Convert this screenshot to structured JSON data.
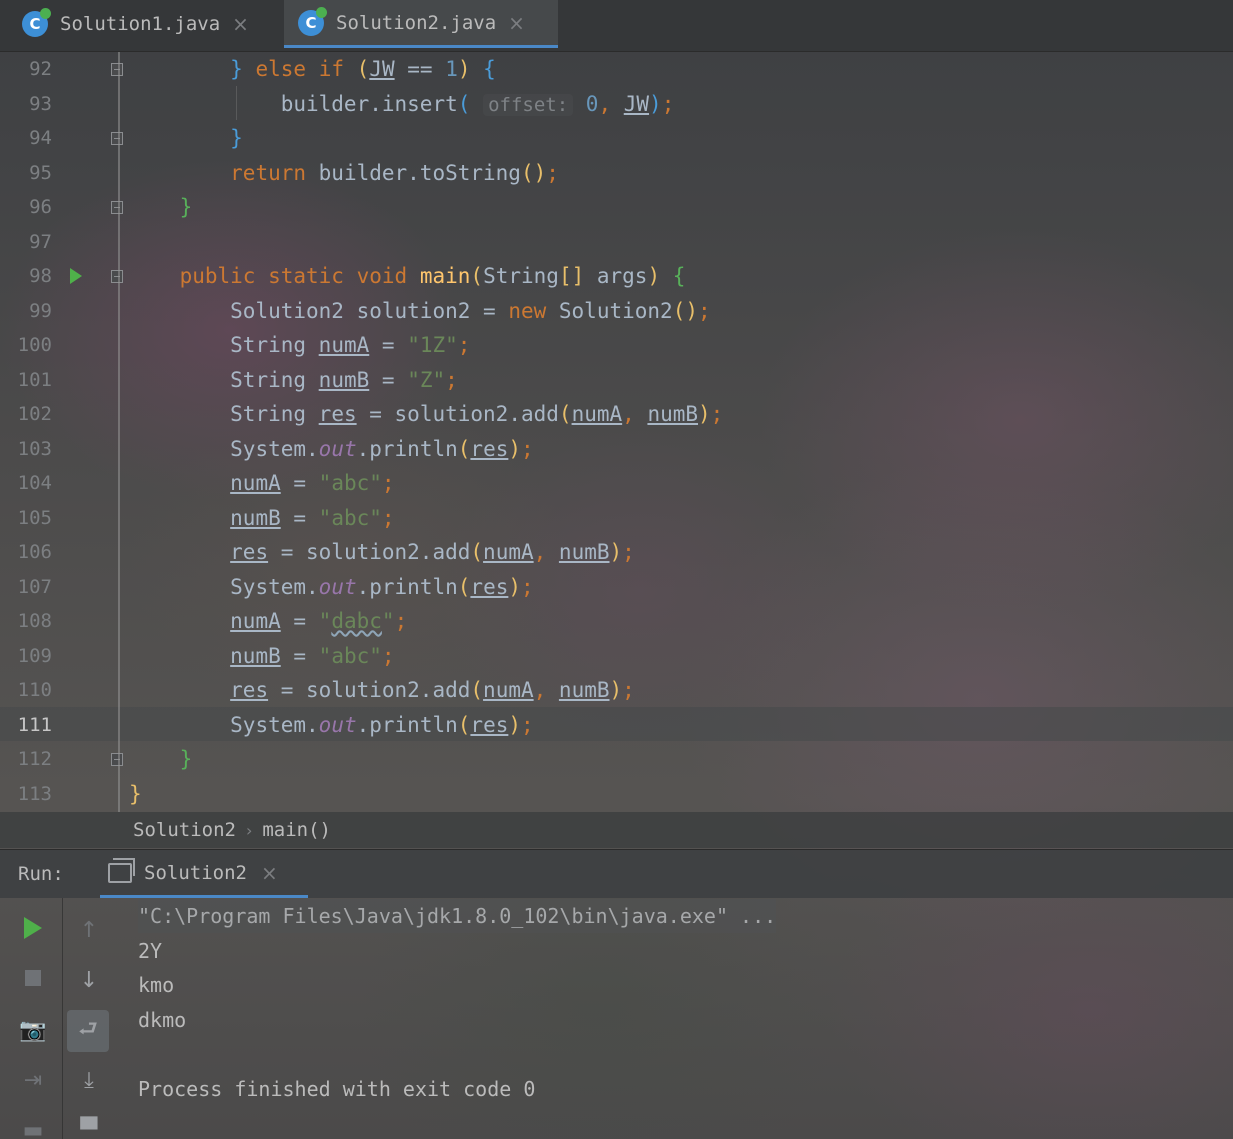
{
  "tabs": [
    {
      "label": "Solution1.java",
      "icon": "java-class-icon",
      "active": false
    },
    {
      "label": "Solution2.java",
      "icon": "java-class-icon",
      "active": true
    }
  ],
  "editor": {
    "line_numbers": [
      "92",
      "93",
      "94",
      "95",
      "96",
      "97",
      "98",
      "99",
      "100",
      "101",
      "102",
      "103",
      "104",
      "105",
      "106",
      "107",
      "108",
      "109",
      "110",
      "111",
      "112",
      "113"
    ],
    "current_line": "111",
    "code": {
      "l92": {
        "close": "}",
        "kw_else": "else",
        "kw_if": "if",
        "p_open": "(",
        "jw": "JW",
        "op": " == ",
        "one": "1",
        "p_close": ")",
        "brace": "{"
      },
      "l93": {
        "builder": "builder",
        "dot_insert": ".insert",
        "p_open": "(",
        "hint": "offset:",
        "zero": "0",
        "comma": ", ",
        "jw": "JW",
        "p_close": ")",
        "semi": ";"
      },
      "l94": {
        "close": "}"
      },
      "l95": {
        "kw_return": "return",
        "rest": " builder.toString",
        "parens": "()",
        "semi": ";"
      },
      "l96": {
        "close": "}"
      },
      "l98": {
        "kw_public": "public",
        "kw_static": "static",
        "kw_void": "void",
        "fn_main": "main",
        "p_open": "(",
        "type": "String",
        "arr": "[]",
        "args": " args",
        "p_close": ")",
        "brace": "{"
      },
      "l99": {
        "decl": "Solution2 solution2 = ",
        "kw_new": "new",
        "cls": " Solution2",
        "parens": "()",
        "semi": ";"
      },
      "l100": {
        "type": "String ",
        "var": "numA",
        "eq": " = ",
        "str": "\"1Z\"",
        "semi": ";"
      },
      "l101": {
        "type": "String ",
        "var": "numB",
        "eq": " = ",
        "str": "\"Z\"",
        "semi": ";"
      },
      "l102": {
        "type": "String ",
        "var": "res",
        "eq": " = solution2.add",
        "p_open": "(",
        "a": "numA",
        "comma": ", ",
        "b": "numB",
        "p_close": ")",
        "semi": ";"
      },
      "l103": {
        "sys": "System.",
        "out": "out",
        "println": ".println",
        "p_open": "(",
        "res": "res",
        "p_close": ")",
        "semi": ";"
      },
      "l104": {
        "var": "numA",
        "eq": " = ",
        "str": "\"abc\"",
        "semi": ";"
      },
      "l105": {
        "var": "numB",
        "eq": " = ",
        "str": "\"abc\"",
        "semi": ";"
      },
      "l106": {
        "var": "res",
        "eq": " = solution2.add",
        "p_open": "(",
        "a": "numA",
        "comma": ", ",
        "b": "numB",
        "p_close": ")",
        "semi": ";"
      },
      "l107": {
        "sys": "System.",
        "out": "out",
        "println": ".println",
        "p_open": "(",
        "res": "res",
        "p_close": ")",
        "semi": ";"
      },
      "l108": {
        "var": "numA",
        "eq": " = ",
        "q1": "\"",
        "str": "dabc",
        "q2": "\"",
        "semi": ";"
      },
      "l109": {
        "var": "numB",
        "eq": " = ",
        "str": "\"abc\"",
        "semi": ";"
      },
      "l110": {
        "var": "res",
        "eq": " = solution2.add",
        "p_open": "(",
        "a": "numA",
        "comma": ", ",
        "b": "numB",
        "p_close": ")",
        "semi": ";"
      },
      "l111": {
        "sys": "System.",
        "out": "out",
        "println": ".println",
        "p_open": "(",
        "res": "res",
        "p_close": ")",
        "semi": ";"
      },
      "l112": {
        "close": "}"
      },
      "l113": {
        "close": "}"
      }
    }
  },
  "breadcrumb": {
    "class": "Solution2",
    "method": "main()",
    "separator": "›"
  },
  "run": {
    "label": "Run:",
    "tab_label": "Solution2",
    "console": [
      "\"C:\\Program Files\\Java\\jdk1.8.0_102\\bin\\java.exe\" ...",
      "2Y",
      "kmo",
      "dkmo",
      "",
      "Process finished with exit code 0"
    ]
  },
  "colors": {
    "keyword": "#cc7832",
    "number": "#6897bb",
    "string": "#6a8759",
    "method": "#ffc66d",
    "field": "#9876aa",
    "text": "#a9b7c6",
    "accent": "#4a88c7",
    "run_green": "#4fb04a"
  }
}
